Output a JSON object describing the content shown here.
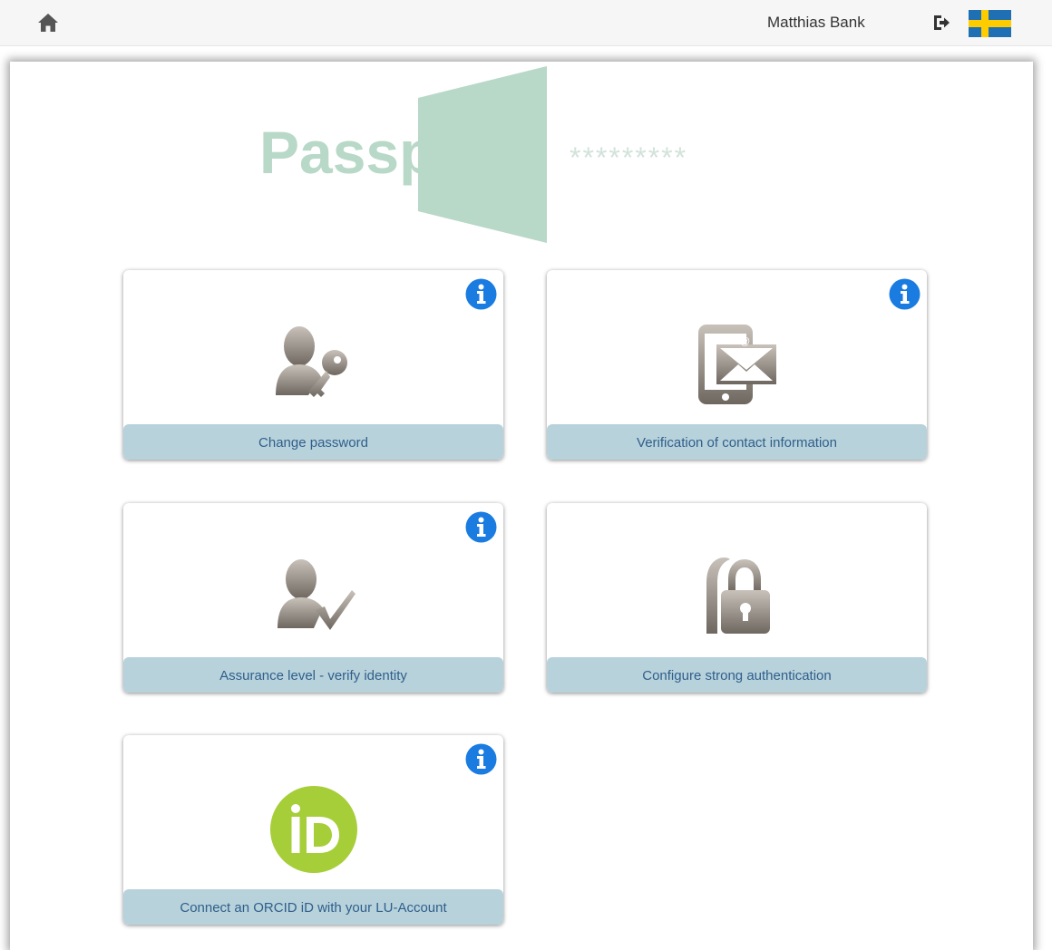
{
  "header": {
    "user_name": "Matthias Bank",
    "icons": {
      "home": "home-icon",
      "logout": "logout-icon",
      "language": "swedish-flag-icon"
    }
  },
  "logo": {
    "word": "Passport",
    "mask": "*********",
    "color": "#b8d8c8"
  },
  "tiles": [
    {
      "label": "Change password",
      "icon": "user-key-icon",
      "has_info": true
    },
    {
      "label": "Verification of contact information",
      "icon": "mobile-mail-icon",
      "has_info": true
    },
    {
      "label": "Assurance level - verify identity",
      "icon": "user-check-icon",
      "has_info": true
    },
    {
      "label": "Configure strong authentication",
      "icon": "padlock-icon",
      "has_info": false
    },
    {
      "label": "Connect an ORCID iD with your LU-Account",
      "icon": "orcid-icon",
      "has_info": true
    }
  ],
  "colors": {
    "tile_label_bg": "#b8d2dc",
    "tile_label_text": "#2f5f8a",
    "info_blue": "#1a7be0",
    "orcid_green": "#a6ce39",
    "icon_gray": "#8a837b"
  }
}
